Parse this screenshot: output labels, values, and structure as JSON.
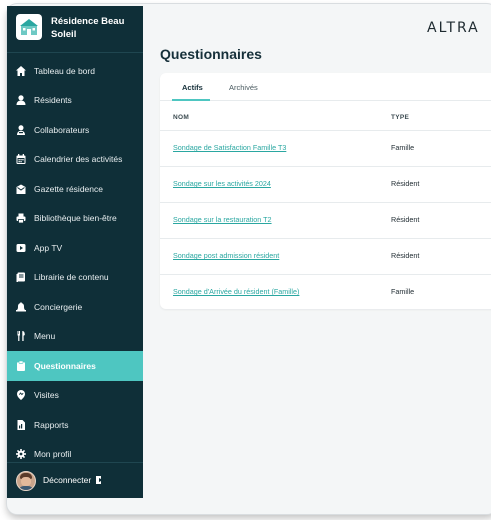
{
  "brand": {
    "name": "Résidence Beau Soleil"
  },
  "brand_mark": "ALTRA",
  "nav": {
    "items": [
      {
        "label": "Tableau de bord",
        "icon": "home-icon"
      },
      {
        "label": "Résidents",
        "icon": "person-icon"
      },
      {
        "label": "Collaborateurs",
        "icon": "staff-icon"
      },
      {
        "label": "Calendrier des activités",
        "icon": "calendar-icon"
      },
      {
        "label": "Gazette résidence",
        "icon": "envelope-icon"
      },
      {
        "label": "Bibliothèque bien-être",
        "icon": "printer-icon"
      },
      {
        "label": "App TV",
        "icon": "play-icon"
      },
      {
        "label": "Librairie de contenu",
        "icon": "library-icon"
      },
      {
        "label": "Conciergerie",
        "icon": "bell-icon"
      },
      {
        "label": "Menu",
        "icon": "cutlery-icon"
      },
      {
        "label": "Questionnaires",
        "icon": "clipboard-icon",
        "active": true
      },
      {
        "label": "Visites",
        "icon": "pin-icon"
      },
      {
        "label": "Rapports",
        "icon": "report-icon"
      },
      {
        "label": "Mon profil",
        "icon": "gear-icon"
      }
    ]
  },
  "footer": {
    "logout_label": "Déconnecter"
  },
  "main": {
    "title": "Questionnaires",
    "tabs": [
      {
        "label": "Actifs",
        "active": true
      },
      {
        "label": "Archivés",
        "active": false
      }
    ],
    "columns": [
      "NOM",
      "TYPE"
    ],
    "rows": [
      {
        "name": "Sondage de Satisfaction Famille T3",
        "type": "Famille"
      },
      {
        "name": "Sondage sur les activités 2024",
        "type": "Résident"
      },
      {
        "name": "Sondage sur la restauration T2",
        "type": "Résident"
      },
      {
        "name": "Sondage post admission résident",
        "type": "Résident"
      },
      {
        "name": "Sondage d'Arrivée du résident (Famille)",
        "type": "Famille"
      }
    ]
  },
  "colors": {
    "sidebar": "#0f2f38",
    "accent": "#4ec6c1",
    "link": "#2aa7a1"
  }
}
